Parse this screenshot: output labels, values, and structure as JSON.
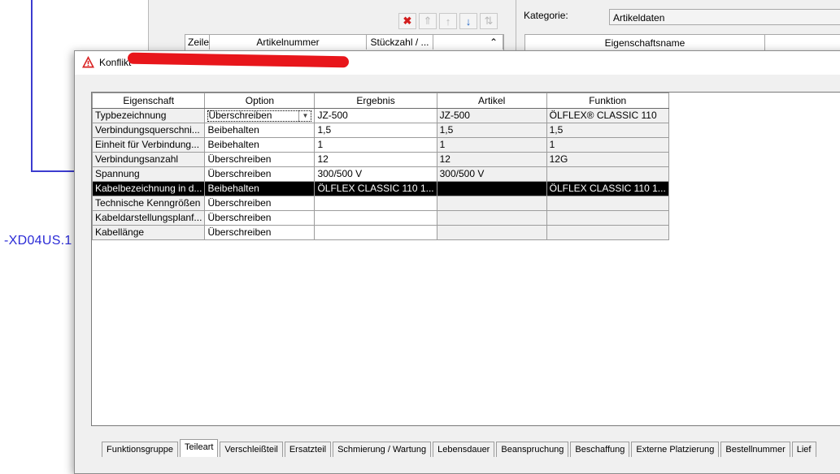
{
  "background": {
    "device_label": "-XD04US.1",
    "parts_list": {
      "columns": [
        "Zeile",
        "Artikelnummer",
        "Stückzahl / ...",
        ""
      ]
    },
    "properties": {
      "category_label": "Kategorie:",
      "category_value": "Artikeldaten",
      "column_name": "Eigenschaftsname"
    }
  },
  "dialog": {
    "title": "Konflikt",
    "columns": [
      "Eigenschaft",
      "Option",
      "Ergebnis",
      "Artikel",
      "Funktion"
    ],
    "rows": [
      {
        "property": "Typbezeichnung",
        "option": "Überschreiben",
        "result": "JZ-500",
        "article": "JZ-500",
        "function": "ÖLFLEX® CLASSIC 110"
      },
      {
        "property": "Verbindungsquerschni...",
        "option": "Beibehalten",
        "result": "1,5",
        "article": "1,5",
        "function": "1,5"
      },
      {
        "property": "Einheit für Verbindung...",
        "option": "Beibehalten",
        "result": "1",
        "article": "1",
        "function": "1"
      },
      {
        "property": "Verbindungsanzahl",
        "option": "Überschreiben",
        "result": "12",
        "article": "12",
        "function": "12G"
      },
      {
        "property": "Spannung",
        "option": "Überschreiben",
        "result": "300/500 V",
        "article": "300/500 V",
        "function": ""
      },
      {
        "property": "Kabelbezeichnung in d...",
        "option": "Beibehalten",
        "result": "ÖLFLEX CLASSIC 110 1...",
        "article": "",
        "function": "ÖLFLEX CLASSIC 110 1..."
      },
      {
        "property": "Technische Kenngrößen",
        "option": "Überschreiben",
        "result": "",
        "article": "",
        "function": ""
      },
      {
        "property": "Kabeldarstellungsplanf...",
        "option": "Überschreiben",
        "result": "",
        "article": "",
        "function": ""
      },
      {
        "property": "Kabellänge",
        "option": "Überschreiben",
        "result": "",
        "article": "",
        "function": ""
      }
    ]
  },
  "tabs": [
    "Funktionsgruppe",
    "Teileart",
    "Verschleißteil",
    "Ersatzteil",
    "Schmierung / Wartung",
    "Lebensdauer",
    "Beanspruchung",
    "Beschaffung",
    "Externe Platzierung",
    "Bestellnummer",
    "Lief"
  ],
  "colors": {
    "selection": "#000000",
    "line_blue": "#3c3ccf",
    "redaction": "#e8161b",
    "delete_red": "#d21c1c",
    "move_blue": "#1c63c7"
  },
  "icons": {
    "title": "warning-triangle-icon",
    "toolbar": [
      "delete-icon",
      "move-top-icon",
      "move-up-icon",
      "move-down-icon",
      "sort-icon"
    ],
    "combo": "chevron-down-icon"
  }
}
